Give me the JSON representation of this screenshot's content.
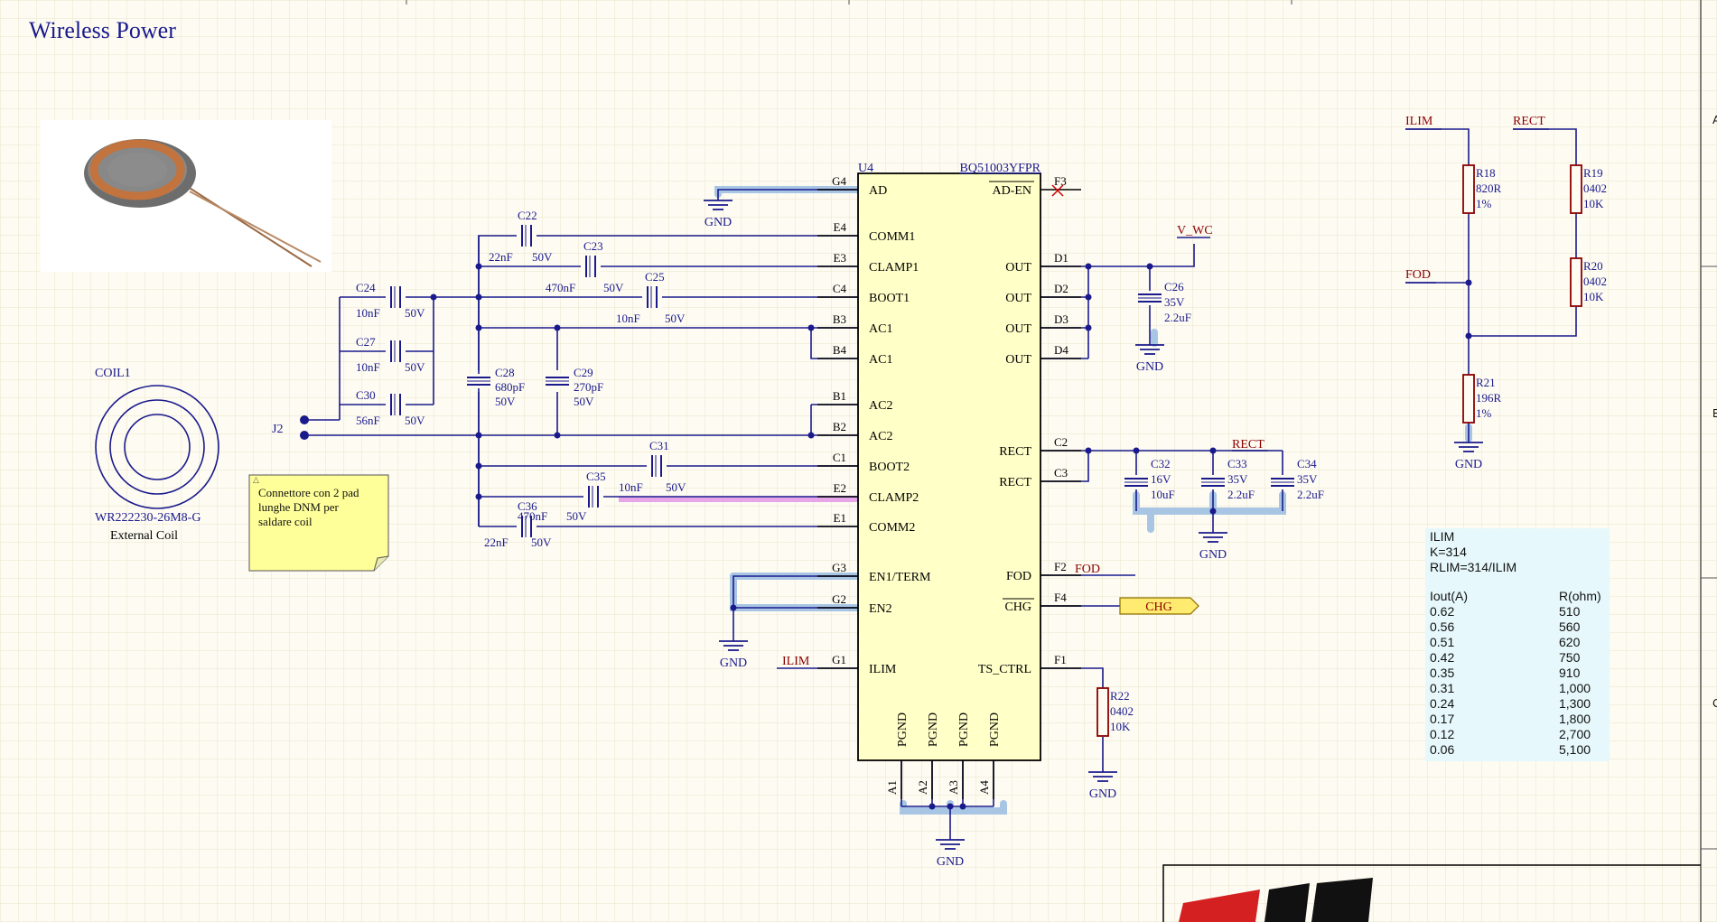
{
  "title": "Wireless Power",
  "u4": {
    "ref": "U4",
    "part": "BQ51003YFPR",
    "left_pins": [
      {
        "num": "G4",
        "name": "AD"
      },
      {
        "num": "E4",
        "name": "COMM1"
      },
      {
        "num": "E3",
        "name": "CLAMP1"
      },
      {
        "num": "C4",
        "name": "BOOT1"
      },
      {
        "num": "B3",
        "name": "AC1"
      },
      {
        "num": "B4",
        "name": "AC1"
      },
      {
        "num": "B1",
        "name": "AC2"
      },
      {
        "num": "B2",
        "name": "AC2"
      },
      {
        "num": "C1",
        "name": "BOOT2"
      },
      {
        "num": "E2",
        "name": "CLAMP2"
      },
      {
        "num": "E1",
        "name": "COMM2"
      },
      {
        "num": "G3",
        "name": "EN1/TERM"
      },
      {
        "num": "G2",
        "name": "EN2"
      },
      {
        "num": "G1",
        "name": "ILIM"
      }
    ],
    "right_pins": [
      {
        "num": "F3",
        "name": "AD-EN"
      },
      {
        "num": "D1",
        "name": "OUT"
      },
      {
        "num": "D2",
        "name": "OUT"
      },
      {
        "num": "D3",
        "name": "OUT"
      },
      {
        "num": "D4",
        "name": "OUT"
      },
      {
        "num": "C2",
        "name": "RECT"
      },
      {
        "num": "C3",
        "name": "RECT"
      },
      {
        "num": "F2",
        "name": "FOD"
      },
      {
        "num": "F4",
        "name": "CHG"
      },
      {
        "num": "F1",
        "name": "TS_CTRL"
      }
    ],
    "bottom_pins": [
      {
        "num": "A1",
        "name": "PGND"
      },
      {
        "num": "A2",
        "name": "PGND"
      },
      {
        "num": "A3",
        "name": "PGND"
      },
      {
        "num": "A4",
        "name": "PGND"
      }
    ]
  },
  "capacitors": [
    {
      "ref": "C22",
      "value": "22nF",
      "voltage": "50V"
    },
    {
      "ref": "C23",
      "value": "470nF",
      "voltage": "50V"
    },
    {
      "ref": "C25",
      "value": "10nF",
      "voltage": "50V"
    },
    {
      "ref": "C24",
      "value": "10nF",
      "voltage": "50V"
    },
    {
      "ref": "C27",
      "value": "10nF",
      "voltage": "50V"
    },
    {
      "ref": "C30",
      "value": "56nF",
      "voltage": "50V"
    },
    {
      "ref": "C28",
      "value": "680pF",
      "voltage": "50V"
    },
    {
      "ref": "C29",
      "value": "270pF",
      "voltage": "50V"
    },
    {
      "ref": "C31",
      "value": "",
      "voltage": ""
    },
    {
      "ref": "C35",
      "value": "10nF",
      "voltage": "50V"
    },
    {
      "ref": "C36",
      "value": "470nF",
      "voltage": "50V"
    },
    {
      "ref": "C26",
      "value": "35V",
      "voltage": "2.2uF"
    },
    {
      "ref": "C32",
      "value": "16V",
      "voltage": "10uF"
    },
    {
      "ref": "C33",
      "value": "35V",
      "voltage": "2.2uF"
    },
    {
      "ref": "C34",
      "value": "35V",
      "voltage": "2.2uF"
    }
  ],
  "c36_extra": {
    "value": "22nF",
    "voltage": "50V"
  },
  "resistors": [
    {
      "ref": "R18",
      "l1": "820R",
      "l2": "1%"
    },
    {
      "ref": "R19",
      "l1": "0402",
      "l2": "10K"
    },
    {
      "ref": "R20",
      "l1": "0402",
      "l2": "10K"
    },
    {
      "ref": "R21",
      "l1": "196R",
      "l2": "1%"
    },
    {
      "ref": "R22",
      "l1": "0402",
      "l2": "10K"
    }
  ],
  "nets": {
    "gnd": "GND",
    "v_wc": "V_WC",
    "rect": "RECT",
    "ilim": "ILIM",
    "fod": "FOD",
    "chg": "CHG"
  },
  "coil": {
    "ref": "COIL1",
    "part": "WR222230-26M8-G",
    "desc": "External Coil"
  },
  "connector": {
    "ref": "J2"
  },
  "note": {
    "lines": [
      "Connettore con 2 pad",
      "lunghe DNM per",
      "saldare coil"
    ]
  },
  "ilim_table": {
    "title": "ILIM",
    "k": "K=314",
    "formula": "RLIM=314/ILIM",
    "headers": [
      "Iout(A)",
      "R(ohm)"
    ],
    "rows": [
      [
        "0.62",
        "510"
      ],
      [
        "0.56",
        "560"
      ],
      [
        "0.51",
        "620"
      ],
      [
        "0.42",
        "750"
      ],
      [
        "0.35",
        "910"
      ],
      [
        "0.31",
        "1,000"
      ],
      [
        "0.24",
        "1,300"
      ],
      [
        "0.17",
        "1,800"
      ],
      [
        "0.12",
        "2,700"
      ],
      [
        "0.06",
        "5,100"
      ]
    ]
  },
  "border_letters": [
    "A",
    "B",
    "C"
  ],
  "colors": {
    "wire": "#1a1a8c",
    "highlight": "#a8c6e4",
    "chip_fill": "#ffffc8",
    "net_label": "#8b0000",
    "logo": "#d42020"
  }
}
